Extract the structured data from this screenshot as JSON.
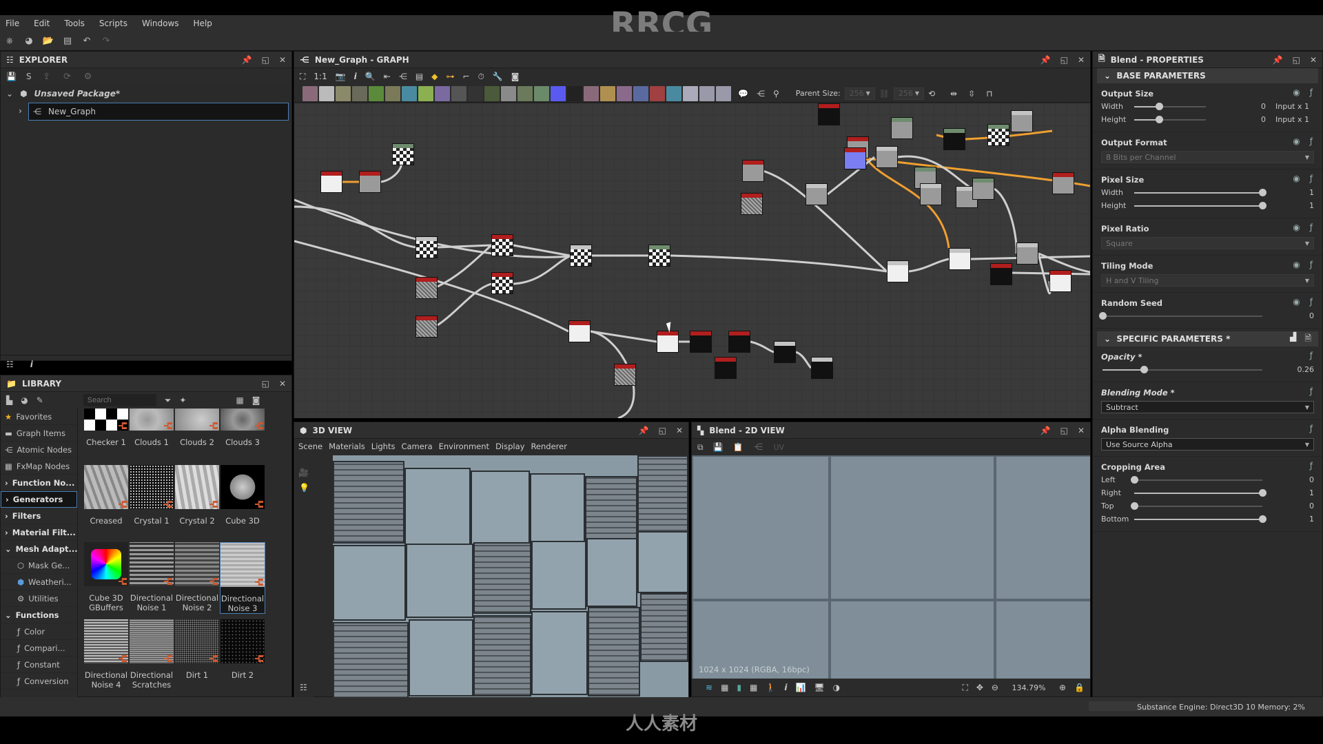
{
  "watermark_title": "RRCG",
  "watermark_bottom": "人人素材",
  "menu": [
    "File",
    "Edit",
    "Tools",
    "Scripts",
    "Windows",
    "Help"
  ],
  "explorer": {
    "title": "EXPLORER",
    "package": "Unsaved Package*",
    "graph": "New_Graph"
  },
  "library": {
    "title": "LIBRARY",
    "search_placeholder": "Search",
    "sidebar": [
      {
        "label": "Favorites",
        "icon": "star-icon",
        "bold": false
      },
      {
        "label": "Graph Items",
        "icon": "comment-icon",
        "bold": false
      },
      {
        "label": "Atomic Nodes",
        "icon": "atomic-nodes-icon",
        "bold": false
      },
      {
        "label": "FxMap Nodes",
        "icon": "fxmap-icon",
        "bold": false
      },
      {
        "label": "Function No...",
        "icon": "chevron-right-icon",
        "bold": true
      },
      {
        "label": "Generators",
        "icon": "chevron-right-icon",
        "bold": true,
        "selected": true
      },
      {
        "label": "Filters",
        "icon": "chevron-right-icon",
        "bold": true
      },
      {
        "label": "Material Filt...",
        "icon": "chevron-right-icon",
        "bold": true
      },
      {
        "label": "Mesh Adapt...",
        "icon": "chevron-down-icon",
        "bold": true
      },
      {
        "label": "Mask Ge...",
        "icon": "cube-outline-icon",
        "sub": true
      },
      {
        "label": "Weatheri...",
        "icon": "cube-blue-icon",
        "sub": true
      },
      {
        "label": "Utilities",
        "icon": "utilities-icon",
        "sub": true
      },
      {
        "label": "Functions",
        "icon": "chevron-down-icon",
        "bold": true
      },
      {
        "label": "Color",
        "icon": "function-icon",
        "sub": true
      },
      {
        "label": "Compari...",
        "icon": "function-icon",
        "sub": true
      },
      {
        "label": "Constant",
        "icon": "function-icon",
        "sub": true
      },
      {
        "label": "Conversion",
        "icon": "function-icon",
        "sub": true
      }
    ],
    "items": [
      {
        "label": "Checker 1"
      },
      {
        "label": "Clouds 1"
      },
      {
        "label": "Clouds 2"
      },
      {
        "label": "Clouds 3"
      },
      {
        "label": "Creased"
      },
      {
        "label": "Crystal 1"
      },
      {
        "label": "Crystal 2"
      },
      {
        "label": "Cube 3D"
      },
      {
        "label": "Cube 3D GBuffers"
      },
      {
        "label": "Directional Noise 1"
      },
      {
        "label": "Directional Noise 2"
      },
      {
        "label": "Directional Noise 3",
        "selected": true
      },
      {
        "label": "Directional Noise 4"
      },
      {
        "label": "Directional Scratches"
      },
      {
        "label": "Dirt 1"
      },
      {
        "label": "Dirt 2"
      }
    ]
  },
  "graph": {
    "title": "New_Graph - GRAPH",
    "parent_size_label": "Parent Size:",
    "parent_size_w": "256",
    "parent_size_h": "256"
  },
  "view3d": {
    "title": "3D VIEW",
    "menu": [
      "Scene",
      "Materials",
      "Lights",
      "Camera",
      "Environment",
      "Display",
      "Renderer"
    ]
  },
  "view2d": {
    "title": "Blend - 2D VIEW",
    "uv_label": "UV",
    "info": "1024 x 1024 (RGBA, 16bpc)",
    "zoom": "134.79%"
  },
  "properties": {
    "title": "Blend - PROPERTIES",
    "base_section": "BASE PARAMETERS",
    "output_size": {
      "label": "Output Size",
      "width_label": "Width",
      "width_val": "0",
      "width_mode": "Input x 1",
      "width_frac": 0.35,
      "height_label": "Height",
      "height_val": "0",
      "height_mode": "Input x 1",
      "height_frac": 0.35
    },
    "output_format": {
      "label": "Output Format",
      "value": "8 Bits per Channel"
    },
    "pixel_size": {
      "label": "Pixel Size",
      "width_label": "Width",
      "width_val": "1",
      "width_frac": 1.0,
      "height_label": "Height",
      "height_val": "1",
      "height_frac": 1.0
    },
    "pixel_ratio": {
      "label": "Pixel Ratio",
      "value": "Square"
    },
    "tiling_mode": {
      "label": "Tiling Mode",
      "value": "H and V Tiling"
    },
    "random_seed": {
      "label": "Random Seed",
      "value": "0",
      "frac": 0.0
    },
    "specific_section": "SPECIFIC PARAMETERS *",
    "opacity": {
      "label": "Opacity *",
      "value": "0.26",
      "frac": 0.26
    },
    "blending_mode": {
      "label": "Blending Mode *",
      "value": "Subtract"
    },
    "alpha_blending": {
      "label": "Alpha Blending",
      "value": "Use Source Alpha"
    },
    "cropping": {
      "label": "Cropping Area",
      "rows": [
        {
          "label": "Left",
          "value": "0",
          "frac": 0.0
        },
        {
          "label": "Right",
          "value": "1",
          "frac": 1.0
        },
        {
          "label": "Top",
          "value": "0",
          "frac": 0.0
        },
        {
          "label": "Bottom",
          "value": "1",
          "frac": 1.0
        }
      ]
    }
  },
  "status": {
    "text": "Substance Engine: Direct3D 10  Memory: 2%"
  }
}
